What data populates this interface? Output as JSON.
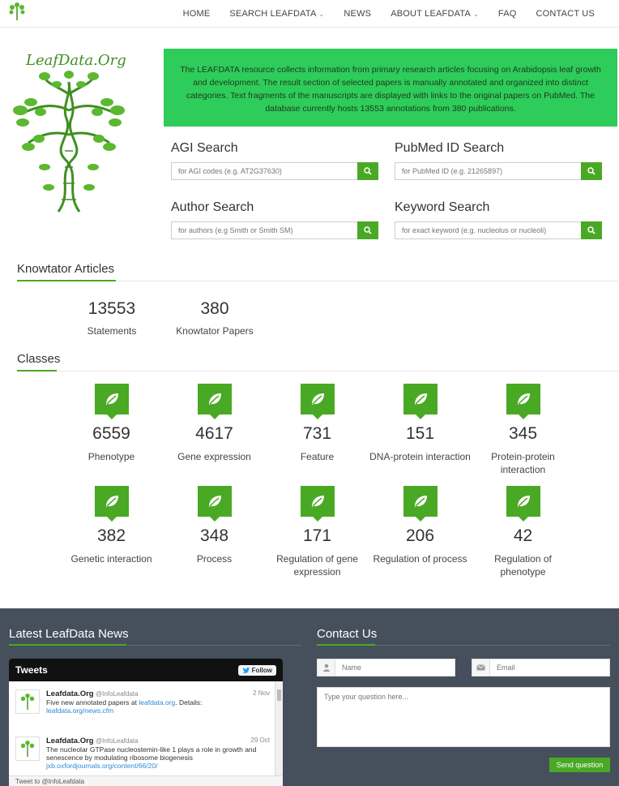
{
  "nav": {
    "items": [
      {
        "label": "HOME",
        "caret": false
      },
      {
        "label": "SEARCH LEAFDATA",
        "caret": true
      },
      {
        "label": "NEWS",
        "caret": false
      },
      {
        "label": "ABOUT LEAFDATA",
        "caret": true
      },
      {
        "label": "FAQ",
        "caret": false
      },
      {
        "label": "CONTACT US",
        "caret": false
      }
    ]
  },
  "hero": {
    "brand": "LeafData.Org",
    "intro": "The LEAFDATA resource collects information from primary research articles focusing on Arabidopsis leaf growth and development. The result section of selected papers is manually annotated and organized into distinct categories. Text fragments of the manuscripts are displayed with links to the original papers on PubMed. The database currently hosts 13553 annotations from 380 publications.",
    "accent": "#2ecc5a"
  },
  "search": {
    "agi": {
      "title": "AGI Search",
      "placeholder": "for AGI codes (e.g. AT2G37630)"
    },
    "pubmed": {
      "title": "PubMed ID Search",
      "placeholder": "for PubMed ID (e.g. 21265897)"
    },
    "author": {
      "title": "Author Search",
      "placeholder": "for authors (e.g Smith or Smith SM)"
    },
    "keyword": {
      "title": "Keyword Search",
      "placeholder": "for exact keyword (e.g. nucleolus or nucleoli)"
    }
  },
  "knowtator": {
    "title": "Knowtator Articles",
    "stats": [
      {
        "num": "13553",
        "label": "Statements"
      },
      {
        "num": "380",
        "label": "Knowtator Papers"
      }
    ]
  },
  "classes": {
    "title": "Classes",
    "items": [
      {
        "num": "6559",
        "label": "Phenotype"
      },
      {
        "num": "4617",
        "label": "Gene expression"
      },
      {
        "num": "731",
        "label": "Feature"
      },
      {
        "num": "151",
        "label": "DNA-protein interaction"
      },
      {
        "num": "345",
        "label": "Protein-protein interaction"
      },
      {
        "num": "382",
        "label": "Genetic interaction"
      },
      {
        "num": "348",
        "label": "Process"
      },
      {
        "num": "171",
        "label": "Regulation of gene expression"
      },
      {
        "num": "206",
        "label": "Regulation of process"
      },
      {
        "num": "42",
        "label": "Regulation of phenotype"
      }
    ]
  },
  "footer": {
    "news_title": "Latest LeafData News",
    "contact_title": "Contact Us",
    "tweets_title": "Tweets",
    "follow_label": "Follow",
    "tweets": [
      {
        "name": "Leafdata.Org",
        "handle": "@InfoLeafdata",
        "date": "2 Nov",
        "text": "Five new annotated papers at ",
        "link1": "leafdata.org",
        "text2": ". Details: ",
        "link2": "leafdata.org/news.cfm"
      },
      {
        "name": "Leafdata.Org",
        "handle": "@InfoLeafdata",
        "date": "29 Oct",
        "text": "The nucleolar GTPase nucleostemin-like 1 plays a role in growth and senescence by modulating ribosome biogenesis",
        "link1": "jxb.oxfordjournals.org/content/66/20/",
        "text2": "",
        "link2": ""
      }
    ],
    "compose": "Tweet to @InfoLeafdata",
    "name_placeholder": "Name",
    "email_placeholder": "Email",
    "question_placeholder": "Type your question here...",
    "send_label": "Send question"
  }
}
